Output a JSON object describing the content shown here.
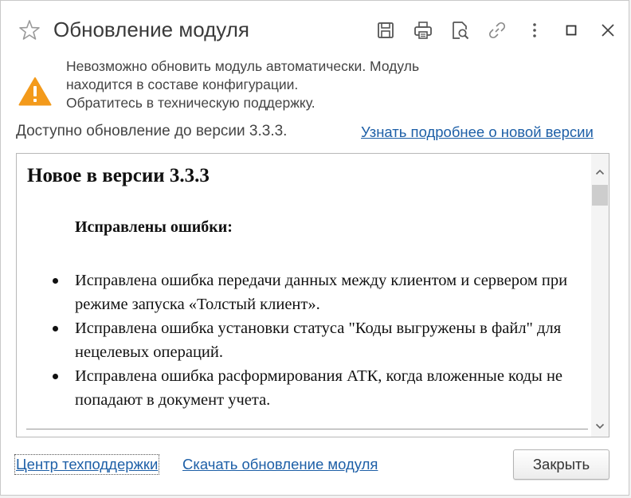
{
  "window": {
    "title": "Обновление модуля",
    "toolbar_icons": [
      "star-icon",
      "save-icon",
      "print-icon",
      "preview-icon",
      "link-icon",
      "more-icon",
      "maximize-icon",
      "close-icon"
    ]
  },
  "warning": {
    "icon": "warning-icon",
    "color": "#f39a1b",
    "lines": [
      "Невозможно обновить модуль автоматически. Модуль",
      "находится в составе конфигурации.",
      "Обратитесь в техническую поддержку."
    ]
  },
  "update": {
    "available_text": "Доступно обновление до версии 3.3.3.",
    "learn_more_link": "Узнать подробнее о новой версии"
  },
  "release_notes": {
    "heading": "Новое в версии 3.3.3",
    "section_heading": "Исправлены ошибки:",
    "items": [
      "Исправлена ошибка передачи данных между клиентом и сервером при режиме запуска «Толстый клиент».",
      "Исправлена ошибка установки статуса \"Коды выгружены в файл\" для нецелевых операций.",
      "Исправлена ошибка расформирования АТК, когда вложенные коды не попадают в документ учета."
    ]
  },
  "footer": {
    "support_link": "Центр техподдержки",
    "download_link": "Скачать обновление модуля",
    "close_button": "Закрыть"
  },
  "colors": {
    "link": "#1d5fa7",
    "warning": "#f39a1b"
  }
}
